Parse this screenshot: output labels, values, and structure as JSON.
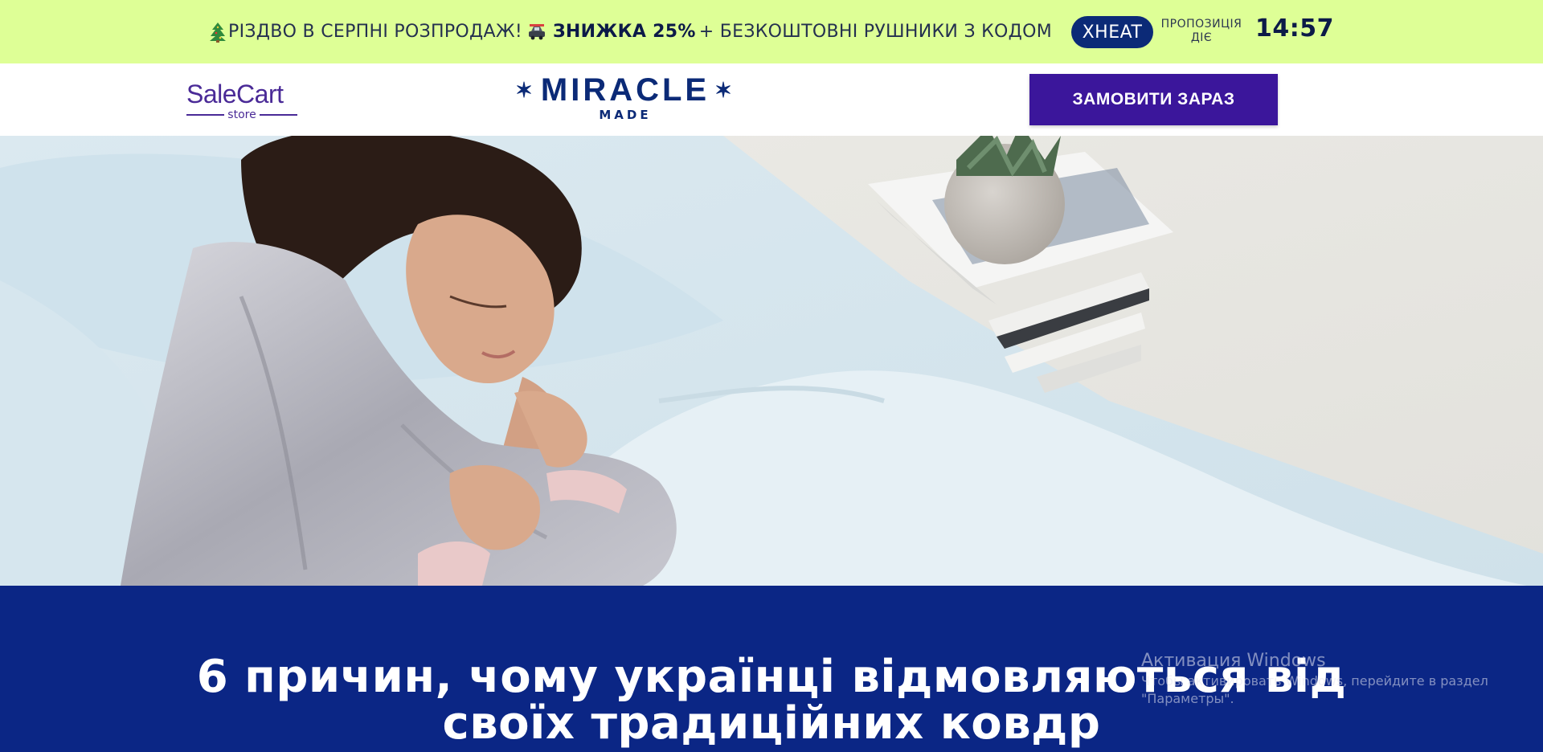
{
  "promo": {
    "part1": "РІЗДВО В СЕРПНІ РОЗПРОДАЖ!",
    "discount": "ЗНИЖКА 25%",
    "part2": "+ БЕЗКОШТОВНІ РУШНИКИ З КОДОМ",
    "code": "XHEAT",
    "offer_line1": "ПРОПОЗИЦІЯ",
    "offer_line2": "ДІЄ",
    "timer": "14:57",
    "tree_icon": "christmas-tree-icon",
    "car_icon": "car-icon",
    "background": "#deff96"
  },
  "header": {
    "store_logo": {
      "main": "SaleCart",
      "sub": "store"
    },
    "brand_logo": {
      "top": "MIRACLE",
      "bottom": "MADE"
    },
    "order_button": "ЗАМОВИТИ ЗАРАЗ",
    "accent": "#3b169b"
  },
  "hero": {
    "image": "woman-sleeping-on-bed-photo"
  },
  "article": {
    "headline": "6 причин, чому українці відмовляються від своїх традиційних ковдр",
    "background": "#0b2685"
  },
  "system_watermark": {
    "title": "Активация Windows",
    "subtitle": "Чтобы активировать Windows, перейдите в раздел \"Параметры\"."
  }
}
